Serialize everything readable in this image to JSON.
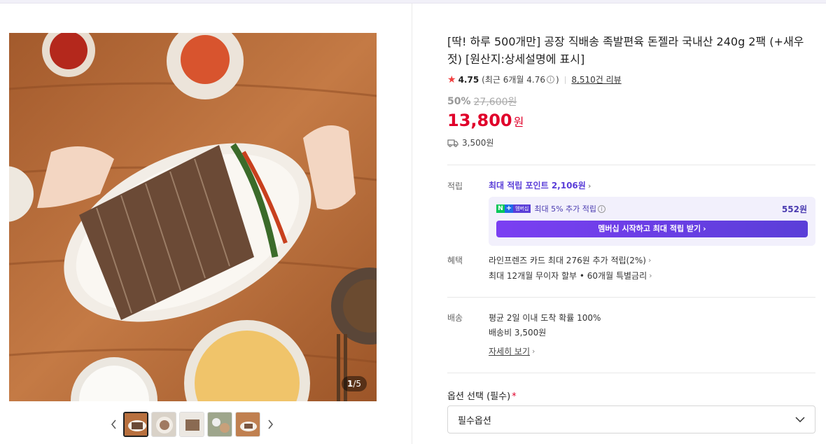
{
  "gallery": {
    "counter_current": "1",
    "counter_total": "/5",
    "thumbnails": [
      "thumb-1",
      "thumb-2",
      "thumb-3",
      "thumb-4",
      "thumb-5"
    ],
    "prev_icon": "chevron-left-icon",
    "next_icon": "chevron-right-icon"
  },
  "product": {
    "title": "[딱! 하루 500개만] 공장 직배송 족발편육 돈젤라 국내산 240g 2팩 (+새우젓) [원산지:상세설명에 표시]",
    "rating": "4.75",
    "recent_rating_text": "(최근 6개월 4.76",
    "recent_rating_close": ")",
    "review_count": "8,510건 리뷰",
    "discount_rate": "50%",
    "original_price": "27,600원",
    "price": "13,800",
    "price_unit": "원",
    "shipping_fee": "3,500원"
  },
  "points": {
    "label": "적립",
    "max_point_link": "최대 적립 포인트 2,106원",
    "membership_badge_n": "N",
    "membership_badge_plus": "+",
    "membership_badge_text": "멤버십",
    "membership_text": "최대 5% 추가 적립",
    "membership_amount": "552원",
    "membership_cta": "멤버십 시작하고 최대 적립 받기"
  },
  "benefits": {
    "label": "혜택",
    "card": "라인프렌즈 카드 최대 276원 추가 적립(2%)",
    "installment": "최대 12개월 무이자 할부 • 60개월 특별금리"
  },
  "delivery": {
    "label": "배송",
    "arrival": "평균 2일 이내 도착 확률 100%",
    "fee": "배송비 3,500원",
    "detail_link": "자세히 보기"
  },
  "option": {
    "label": "옵션 선택 (필수)",
    "required_mark": "*",
    "selected": "필수옵션"
  },
  "colors": {
    "price_red": "#e0002a",
    "accent_purple": "#5a3ed8",
    "star": "#f13e3e"
  }
}
